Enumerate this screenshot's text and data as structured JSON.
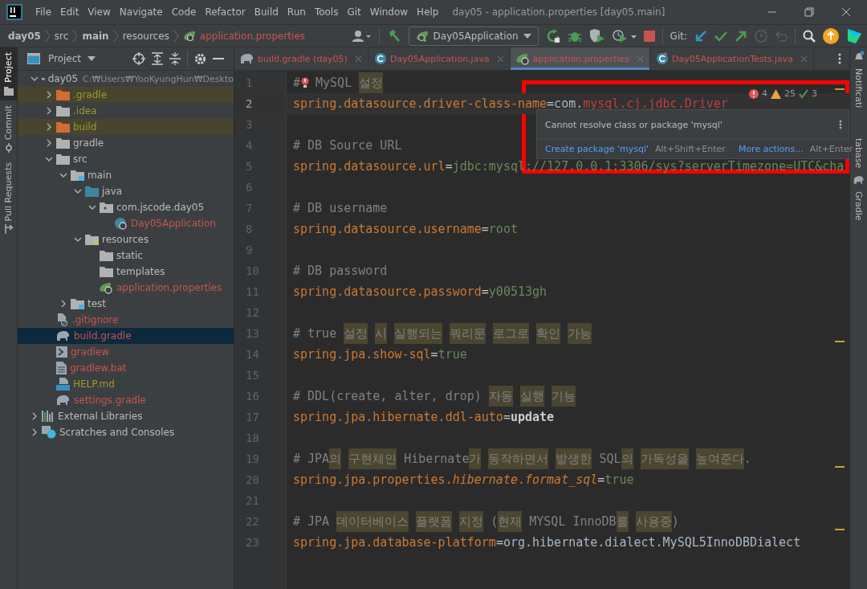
{
  "window": {
    "title": "day05 - application.properties [day05.main]"
  },
  "menu": [
    "File",
    "Edit",
    "View",
    "Navigate",
    "Code",
    "Refactor",
    "Build",
    "Run",
    "Tools",
    "Git",
    "Window",
    "Help"
  ],
  "breadcrumbs": [
    {
      "label": "day05",
      "bold": true
    },
    {
      "label": "src",
      "bold": false
    },
    {
      "label": "main",
      "bold": true
    },
    {
      "label": "resources",
      "bold": false
    },
    {
      "label": "application.properties",
      "bold": false
    }
  ],
  "toolbar": {
    "run_config": "Day05Application",
    "git_label": "Git:"
  },
  "left_strip": [
    {
      "label": "Project",
      "selected": true
    },
    {
      "label": "Commit",
      "selected": false
    },
    {
      "label": "Pull Requests",
      "selected": false
    }
  ],
  "right_strip": [
    {
      "label": "Notificati"
    },
    {
      "label": "tabase"
    },
    {
      "label": "Gradle"
    }
  ],
  "project_panel": {
    "title": "Project"
  },
  "tree": [
    {
      "label": "day05",
      "kind": "module",
      "hint": "C:₩Users₩YooKyungHun₩Deskto",
      "color": "#bbbbbb",
      "expanded": true,
      "selected": false,
      "excluded": false,
      "children": [
        {
          "label": ".gradle",
          "kind": "folder-excluded",
          "color": "#9a9c29",
          "expanded": false,
          "selected": false,
          "excluded": true
        },
        {
          "label": ".idea",
          "kind": "folder",
          "color": "#9a9c29",
          "expanded": false,
          "selected": false,
          "excluded": false
        },
        {
          "label": "build",
          "kind": "folder-excluded",
          "color": "#9a9c29",
          "expanded": false,
          "selected": false,
          "excluded": true
        },
        {
          "label": "gradle",
          "kind": "folder",
          "color": "#bbbbbb",
          "expanded": false,
          "selected": false,
          "excluded": false
        },
        {
          "label": "src",
          "kind": "folder",
          "color": "#bbbbbb",
          "expanded": true,
          "selected": false,
          "excluded": false,
          "children": [
            {
              "label": "main",
              "kind": "module",
              "color": "#bbbbbb",
              "expanded": true,
              "selected": false,
              "excluded": false,
              "children": [
                {
                  "label": "java",
                  "kind": "source",
                  "color": "#bbbbbb",
                  "expanded": true,
                  "selected": false,
                  "excluded": false,
                  "children": [
                    {
                      "label": "com.jscode.day05",
                      "kind": "package",
                      "color": "#bbbbbb",
                      "expanded": true,
                      "selected": false,
                      "excluded": false,
                      "children": [
                        {
                          "label": "Day05Application",
                          "kind": "spring-class",
                          "color": "#c75450",
                          "selected": false,
                          "excluded": false
                        }
                      ]
                    }
                  ]
                },
                {
                  "label": "resources",
                  "kind": "resources",
                  "color": "#bbbbbb",
                  "expanded": true,
                  "selected": false,
                  "excluded": false,
                  "children": [
                    {
                      "label": "static",
                      "kind": "folder",
                      "color": "#bbbbbb",
                      "selected": false,
                      "excluded": false
                    },
                    {
                      "label": "templates",
                      "kind": "folder",
                      "color": "#bbbbbb",
                      "selected": false,
                      "excluded": false
                    },
                    {
                      "label": "application.properties",
                      "kind": "properties",
                      "color": "#c75450",
                      "selected": false,
                      "excluded": false
                    }
                  ]
                }
              ]
            },
            {
              "label": "test",
              "kind": "module",
              "color": "#bbbbbb",
              "expanded": false,
              "selected": false,
              "excluded": false
            }
          ]
        },
        {
          "label": ".gitignore",
          "kind": "ignore-file",
          "color": "#c75450",
          "selected": false,
          "excluded": false
        },
        {
          "label": "build.gradle",
          "kind": "gradle",
          "color": "#c75450",
          "selected": true,
          "excluded": false
        },
        {
          "label": "gradlew",
          "kind": "script",
          "color": "#c75450",
          "selected": false,
          "excluded": false
        },
        {
          "label": "gradlew.bat",
          "kind": "text-file",
          "color": "#c75450",
          "selected": false,
          "excluded": false
        },
        {
          "label": "HELP.md",
          "kind": "markdown",
          "color": "#9a9c29",
          "selected": false,
          "excluded": false
        },
        {
          "label": "settings.gradle",
          "kind": "gradle",
          "color": "#c75450",
          "selected": false,
          "excluded": false
        }
      ]
    },
    {
      "label": "External Libraries",
      "kind": "libraries",
      "color": "#bbbbbb",
      "expanded": false,
      "selected": false,
      "excluded": false
    },
    {
      "label": "Scratches and Consoles",
      "kind": "scratches",
      "color": "#bbbbbb",
      "expanded": false,
      "selected": false,
      "excluded": false
    }
  ],
  "tabs": [
    {
      "label": "build.gradle (day05)",
      "kind": "gradle",
      "selected": false
    },
    {
      "label": "Day05Application.java",
      "kind": "spring-class",
      "selected": false
    },
    {
      "label": "application.properties",
      "kind": "properties",
      "selected": true
    },
    {
      "label": "Day05ApplicationTests.java",
      "kind": "test-class",
      "selected": false
    }
  ],
  "inspections": {
    "errors": "4",
    "warnings": "25",
    "weak": "3"
  },
  "lines": [
    {
      "n": "1",
      "current": false,
      "bulb": true,
      "segs": [
        {
          "t": "#",
          "kind": "comment"
        },
        {
          "t": "MySQL ",
          "kind": "comment"
        },
        {
          "t": "설정",
          "kind": "hl"
        }
      ]
    },
    {
      "n": "2",
      "current": true,
      "bulb": false,
      "segs": [
        {
          "t": "spring.datasource.driver-class-name",
          "kind": "key"
        },
        {
          "t": "=",
          "kind": "eq"
        },
        {
          "t": "com.",
          "kind": "ref"
        },
        {
          "t": "mysql.cj.jdbc.Driver",
          "kind": "error"
        }
      ]
    },
    {
      "n": "3",
      "current": false,
      "bulb": false
    },
    {
      "n": "4",
      "current": false,
      "bulb": false,
      "segs": [
        {
          "t": "# DB Source URL",
          "kind": "comment"
        }
      ]
    },
    {
      "n": "5",
      "current": false,
      "bulb": false,
      "segs": [
        {
          "t": "spring.datasource.url",
          "kind": "key"
        },
        {
          "t": "=",
          "kind": "eq"
        },
        {
          "t": "jdbc:mysql://127.0.0.1:3306/sys?serverTimezone=UTC&cha",
          "kind": "value"
        }
      ]
    },
    {
      "n": "6",
      "current": false,
      "bulb": false
    },
    {
      "n": "7",
      "current": false,
      "bulb": false,
      "segs": [
        {
          "t": "# DB username",
          "kind": "comment"
        }
      ]
    },
    {
      "n": "8",
      "current": false,
      "bulb": false,
      "segs": [
        {
          "t": "spring.datasource.username",
          "kind": "key"
        },
        {
          "t": "=",
          "kind": "eq"
        },
        {
          "t": "root",
          "kind": "value"
        }
      ]
    },
    {
      "n": "9",
      "current": false,
      "bulb": false
    },
    {
      "n": "10",
      "current": false,
      "bulb": false,
      "segs": [
        {
          "t": "# DB password",
          "kind": "comment"
        }
      ]
    },
    {
      "n": "11",
      "current": false,
      "bulb": false,
      "segs": [
        {
          "t": "spring.datasource.password",
          "kind": "key"
        },
        {
          "t": "=",
          "kind": "eq"
        },
        {
          "t": "y00513gh",
          "kind": "value"
        }
      ]
    },
    {
      "n": "12",
      "current": false,
      "bulb": false
    },
    {
      "n": "13",
      "current": false,
      "bulb": false,
      "segs": [
        {
          "t": "# true ",
          "kind": "comment"
        },
        {
          "t": "설정",
          "kind": "hl"
        },
        {
          "t": "시",
          "kind": "hl"
        },
        {
          "t": "실행되는",
          "kind": "hl"
        },
        {
          "t": "쿼리문",
          "kind": "hl"
        },
        {
          "t": "로그로",
          "kind": "hl"
        },
        {
          "t": "확인",
          "kind": "hl"
        },
        {
          "t": "가능",
          "kind": "hl"
        }
      ]
    },
    {
      "n": "14",
      "current": false,
      "bulb": false,
      "segs": [
        {
          "t": "spring.jpa.show-sql",
          "kind": "key"
        },
        {
          "t": "=",
          "kind": "eq"
        },
        {
          "t": "true",
          "kind": "value"
        }
      ]
    },
    {
      "n": "15",
      "current": false,
      "bulb": false
    },
    {
      "n": "16",
      "current": false,
      "bulb": false,
      "segs": [
        {
          "t": "# DDL(create, alter, drop) ",
          "kind": "comment"
        },
        {
          "t": "자동",
          "kind": "hl"
        },
        {
          "t": "실행",
          "kind": "hl"
        },
        {
          "t": "기능",
          "kind": "hl"
        }
      ]
    },
    {
      "n": "17",
      "current": false,
      "bulb": false,
      "segs": [
        {
          "t": "spring.jpa.hibernate.ddl-auto",
          "kind": "key"
        },
        {
          "t": "=",
          "kind": "eq"
        },
        {
          "t": "update",
          "kind": "bold"
        }
      ]
    },
    {
      "n": "18",
      "current": false,
      "bulb": false
    },
    {
      "n": "19",
      "current": false,
      "bulb": false,
      "segs": [
        {
          "t": "# JPA",
          "kind": "comment"
        },
        {
          "t": "의",
          "kind": "hl"
        },
        {
          "t": "구현체인",
          "kind": "hl"
        },
        {
          "t": " Hibernate",
          "kind": "comment"
        },
        {
          "t": "가",
          "kind": "hl"
        },
        {
          "t": "동작하면서",
          "kind": "hl"
        },
        {
          "t": "발생한",
          "kind": "hl"
        },
        {
          "t": " SQL",
          "kind": "comment"
        },
        {
          "t": "의",
          "kind": "hl"
        },
        {
          "t": "가독성을",
          "kind": "hl"
        },
        {
          "t": "높여준다",
          "kind": "hl"
        },
        {
          "t": ".",
          "kind": "comment"
        }
      ]
    },
    {
      "n": "20",
      "current": false,
      "bulb": false,
      "segs": [
        {
          "t": "spring.jpa.properties.",
          "kind": "key"
        },
        {
          "t": "hibernate",
          "kind": "italic"
        },
        {
          "t": ".",
          "kind": "key"
        },
        {
          "t": "format_sql",
          "kind": "italic"
        },
        {
          "t": "=",
          "kind": "eq"
        },
        {
          "t": "true",
          "kind": "value"
        }
      ]
    },
    {
      "n": "21",
      "current": false,
      "bulb": false
    },
    {
      "n": "22",
      "current": false,
      "bulb": false,
      "segs": [
        {
          "t": "# JPA ",
          "kind": "comment"
        },
        {
          "t": "데이터베이스",
          "kind": "hl"
        },
        {
          "t": "플랫폼",
          "kind": "hl"
        },
        {
          "t": "지정",
          "kind": "hl"
        },
        {
          "t": " (",
          "kind": "comment"
        },
        {
          "t": "현재",
          "kind": "hl"
        },
        {
          "t": " MYSQL InnoDB",
          "kind": "comment"
        },
        {
          "t": "를",
          "kind": "hl"
        },
        {
          "t": "사용중",
          "kind": "hl"
        },
        {
          "t": ")",
          "kind": "comment"
        }
      ]
    },
    {
      "n": "23",
      "current": false,
      "bulb": false,
      "segs": [
        {
          "t": "spring.jpa.database-platform",
          "kind": "key"
        },
        {
          "t": "=",
          "kind": "eq"
        },
        {
          "t": "org.hibernate.dialect.MySQL5InnoDBDialect",
          "kind": "ref"
        }
      ]
    }
  ],
  "popup": {
    "message": "Cannot resolve class or package 'mysql'",
    "action": "Create package 'mysql'",
    "action_shortcut": "Alt+Shift+Enter",
    "more": "More actions...",
    "more_shortcut": "Alt+Enter"
  }
}
